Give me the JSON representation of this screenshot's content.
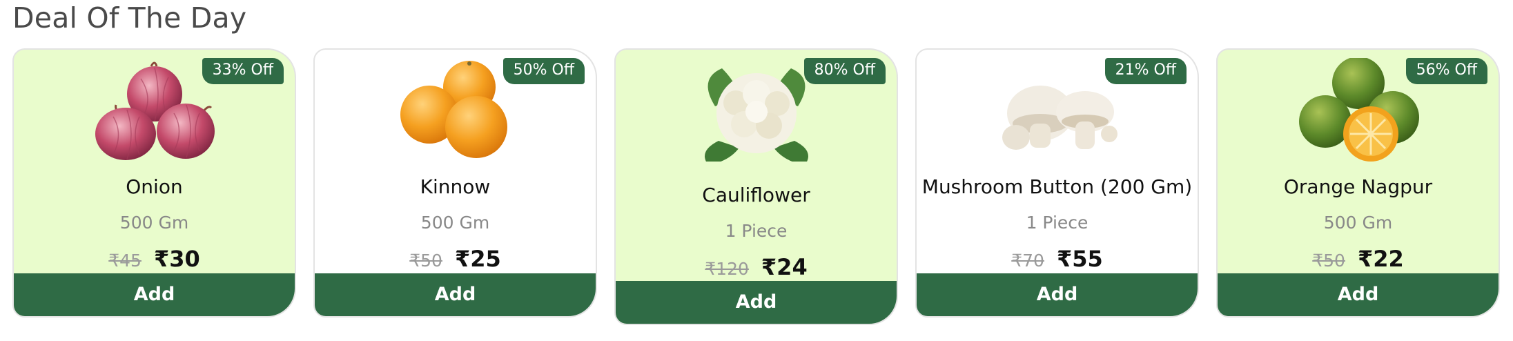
{
  "section": {
    "title": "Deal Of The Day"
  },
  "products": [
    {
      "name": "Onion",
      "quantity": "500 Gm",
      "mrp": "₹45",
      "price": "₹30",
      "discount": "33% Off",
      "add_label": "Add",
      "icon": "onion-icon",
      "bg": "#e9fccc"
    },
    {
      "name": "Kinnow",
      "quantity": "500 Gm",
      "mrp": "₹50",
      "price": "₹25",
      "discount": "50% Off",
      "add_label": "Add",
      "icon": "kinnow-icon",
      "bg": "#ffffff"
    },
    {
      "name": "Cauliflower",
      "quantity": "1 Piece",
      "mrp": "₹120",
      "price": "₹24",
      "discount": "80% Off",
      "add_label": "Add",
      "icon": "cauliflower-icon",
      "bg": "#e9fccc"
    },
    {
      "name": "Mushroom Button (200 Gm)",
      "quantity": "1 Piece",
      "mrp": "₹70",
      "price": "₹55",
      "discount": "21% Off",
      "add_label": "Add",
      "icon": "mushroom-icon",
      "bg": "#ffffff"
    },
    {
      "name": "Orange Nagpur",
      "quantity": "500 Gm",
      "mrp": "₹50",
      "price": "₹22",
      "discount": "56% Off",
      "add_label": "Add",
      "icon": "orange-icon",
      "bg": "#e9fccc"
    }
  ],
  "colors": {
    "accent": "#2f6b45",
    "card_green": "#e9fccc",
    "strike": "#9a9a9a"
  }
}
